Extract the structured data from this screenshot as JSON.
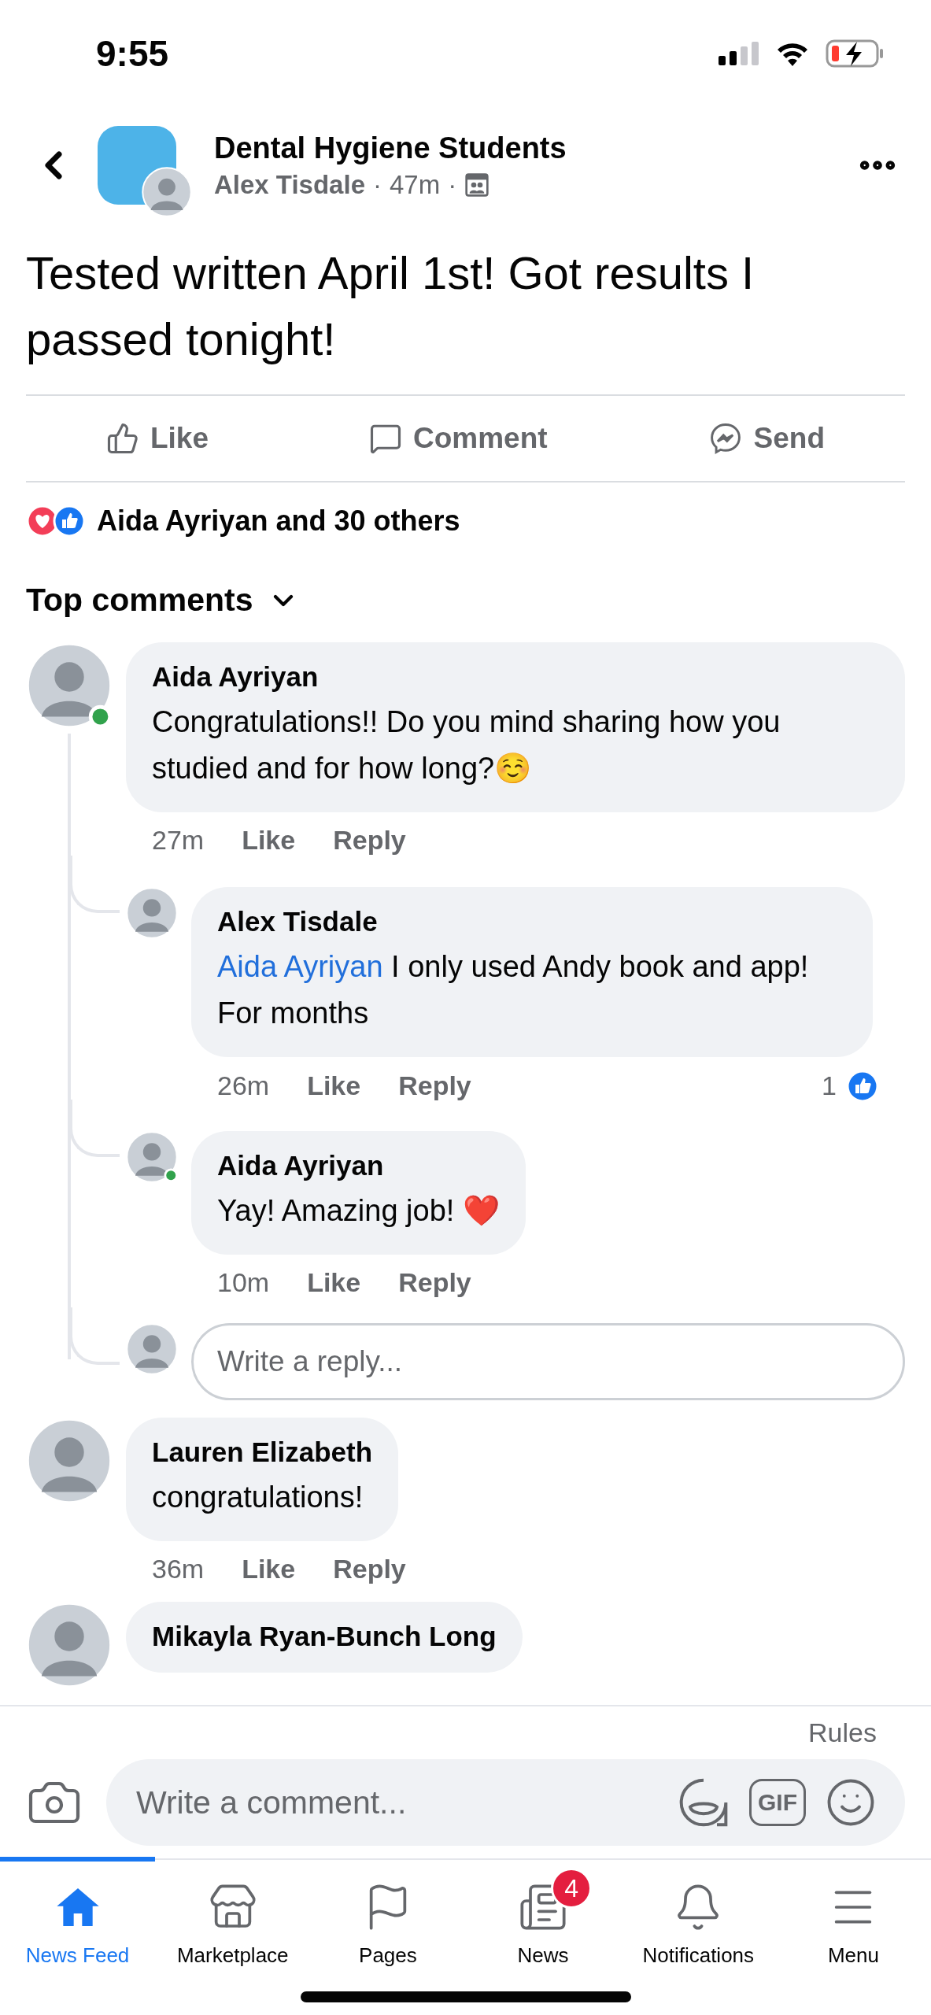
{
  "status_bar": {
    "time": "9:55"
  },
  "header": {
    "group_name": "Dental Hygiene Students",
    "author": "Alex Tisdale",
    "separator_1": "·",
    "time": "47m",
    "separator_2": "·"
  },
  "post": {
    "text": "Tested written April 1st! Got results I passed tonight!"
  },
  "actions": [
    {
      "kind": "like",
      "label": "Like"
    },
    {
      "kind": "comment",
      "label": "Comment"
    },
    {
      "kind": "send",
      "label": "Send"
    }
  ],
  "reactions": {
    "summary": "Aida Ayriyan and 30 others"
  },
  "comments_sort": {
    "label": "Top comments"
  },
  "comments": [
    {
      "author": "Aida Ayriyan",
      "online": true,
      "text": "Congratulations!! Do you mind sharing how you studied and for how long?☺️",
      "time": "27m",
      "actions": [
        "Like",
        "Reply"
      ],
      "replies": [
        {
          "author": "Alex Tisdale",
          "online": false,
          "mention": "Aida Ayriyan",
          "text": "I only used Andy book and app! For months",
          "time": "26m",
          "actions": [
            "Like",
            "Reply"
          ],
          "like_count": "1"
        },
        {
          "author": "Aida Ayriyan",
          "online": true,
          "text": "Yay! Amazing job! ❤️",
          "time": "10m",
          "actions": [
            "Like",
            "Reply"
          ]
        }
      ],
      "reply_field": {
        "placeholder": "Write a reply..."
      }
    },
    {
      "author": "Lauren Elizabeth",
      "online": false,
      "text": "congratulations!",
      "time": "36m",
      "actions": [
        "Like",
        "Reply"
      ]
    },
    {
      "author": "Mikayla Ryan-Bunch Long",
      "online": false
    }
  ],
  "composer": {
    "rules": "Rules",
    "placeholder": "Write a comment...",
    "gif": "GIF"
  },
  "tabs": [
    {
      "kind": "home",
      "label": "News Feed",
      "selected": true
    },
    {
      "kind": "marketplace",
      "label": "Marketplace",
      "selected": false
    },
    {
      "kind": "pages",
      "label": "Pages",
      "selected": false
    },
    {
      "kind": "news",
      "label": "News",
      "selected": false,
      "badge": "4"
    },
    {
      "kind": "notifications",
      "label": "Notifications",
      "selected": false
    },
    {
      "kind": "menu",
      "label": "Menu",
      "selected": false
    }
  ]
}
